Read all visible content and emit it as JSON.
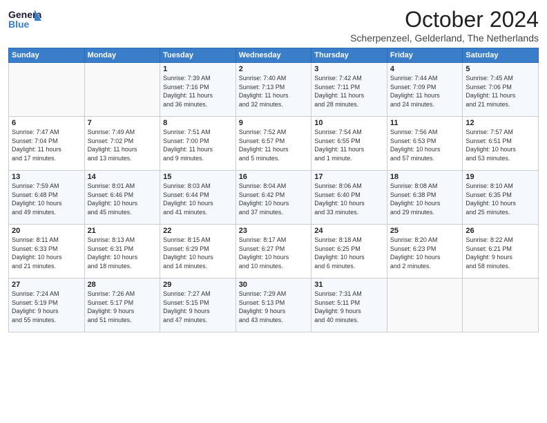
{
  "header": {
    "logo_general": "General",
    "logo_blue": "Blue",
    "month_title": "October 2024",
    "subtitle": "Scherpenzeel, Gelderland, The Netherlands"
  },
  "days_of_week": [
    "Sunday",
    "Monday",
    "Tuesday",
    "Wednesday",
    "Thursday",
    "Friday",
    "Saturday"
  ],
  "weeks": [
    [
      {
        "day": "",
        "info": ""
      },
      {
        "day": "",
        "info": ""
      },
      {
        "day": "1",
        "info": "Sunrise: 7:39 AM\nSunset: 7:16 PM\nDaylight: 11 hours\nand 36 minutes."
      },
      {
        "day": "2",
        "info": "Sunrise: 7:40 AM\nSunset: 7:13 PM\nDaylight: 11 hours\nand 32 minutes."
      },
      {
        "day": "3",
        "info": "Sunrise: 7:42 AM\nSunset: 7:11 PM\nDaylight: 11 hours\nand 28 minutes."
      },
      {
        "day": "4",
        "info": "Sunrise: 7:44 AM\nSunset: 7:09 PM\nDaylight: 11 hours\nand 24 minutes."
      },
      {
        "day": "5",
        "info": "Sunrise: 7:45 AM\nSunset: 7:06 PM\nDaylight: 11 hours\nand 21 minutes."
      }
    ],
    [
      {
        "day": "6",
        "info": "Sunrise: 7:47 AM\nSunset: 7:04 PM\nDaylight: 11 hours\nand 17 minutes."
      },
      {
        "day": "7",
        "info": "Sunrise: 7:49 AM\nSunset: 7:02 PM\nDaylight: 11 hours\nand 13 minutes."
      },
      {
        "day": "8",
        "info": "Sunrise: 7:51 AM\nSunset: 7:00 PM\nDaylight: 11 hours\nand 9 minutes."
      },
      {
        "day": "9",
        "info": "Sunrise: 7:52 AM\nSunset: 6:57 PM\nDaylight: 11 hours\nand 5 minutes."
      },
      {
        "day": "10",
        "info": "Sunrise: 7:54 AM\nSunset: 6:55 PM\nDaylight: 11 hours\nand 1 minute."
      },
      {
        "day": "11",
        "info": "Sunrise: 7:56 AM\nSunset: 6:53 PM\nDaylight: 10 hours\nand 57 minutes."
      },
      {
        "day": "12",
        "info": "Sunrise: 7:57 AM\nSunset: 6:51 PM\nDaylight: 10 hours\nand 53 minutes."
      }
    ],
    [
      {
        "day": "13",
        "info": "Sunrise: 7:59 AM\nSunset: 6:48 PM\nDaylight: 10 hours\nand 49 minutes."
      },
      {
        "day": "14",
        "info": "Sunrise: 8:01 AM\nSunset: 6:46 PM\nDaylight: 10 hours\nand 45 minutes."
      },
      {
        "day": "15",
        "info": "Sunrise: 8:03 AM\nSunset: 6:44 PM\nDaylight: 10 hours\nand 41 minutes."
      },
      {
        "day": "16",
        "info": "Sunrise: 8:04 AM\nSunset: 6:42 PM\nDaylight: 10 hours\nand 37 minutes."
      },
      {
        "day": "17",
        "info": "Sunrise: 8:06 AM\nSunset: 6:40 PM\nDaylight: 10 hours\nand 33 minutes."
      },
      {
        "day": "18",
        "info": "Sunrise: 8:08 AM\nSunset: 6:38 PM\nDaylight: 10 hours\nand 29 minutes."
      },
      {
        "day": "19",
        "info": "Sunrise: 8:10 AM\nSunset: 6:35 PM\nDaylight: 10 hours\nand 25 minutes."
      }
    ],
    [
      {
        "day": "20",
        "info": "Sunrise: 8:11 AM\nSunset: 6:33 PM\nDaylight: 10 hours\nand 21 minutes."
      },
      {
        "day": "21",
        "info": "Sunrise: 8:13 AM\nSunset: 6:31 PM\nDaylight: 10 hours\nand 18 minutes."
      },
      {
        "day": "22",
        "info": "Sunrise: 8:15 AM\nSunset: 6:29 PM\nDaylight: 10 hours\nand 14 minutes."
      },
      {
        "day": "23",
        "info": "Sunrise: 8:17 AM\nSunset: 6:27 PM\nDaylight: 10 hours\nand 10 minutes."
      },
      {
        "day": "24",
        "info": "Sunrise: 8:18 AM\nSunset: 6:25 PM\nDaylight: 10 hours\nand 6 minutes."
      },
      {
        "day": "25",
        "info": "Sunrise: 8:20 AM\nSunset: 6:23 PM\nDaylight: 10 hours\nand 2 minutes."
      },
      {
        "day": "26",
        "info": "Sunrise: 8:22 AM\nSunset: 6:21 PM\nDaylight: 9 hours\nand 58 minutes."
      }
    ],
    [
      {
        "day": "27",
        "info": "Sunrise: 7:24 AM\nSunset: 5:19 PM\nDaylight: 9 hours\nand 55 minutes."
      },
      {
        "day": "28",
        "info": "Sunrise: 7:26 AM\nSunset: 5:17 PM\nDaylight: 9 hours\nand 51 minutes."
      },
      {
        "day": "29",
        "info": "Sunrise: 7:27 AM\nSunset: 5:15 PM\nDaylight: 9 hours\nand 47 minutes."
      },
      {
        "day": "30",
        "info": "Sunrise: 7:29 AM\nSunset: 5:13 PM\nDaylight: 9 hours\nand 43 minutes."
      },
      {
        "day": "31",
        "info": "Sunrise: 7:31 AM\nSunset: 5:11 PM\nDaylight: 9 hours\nand 40 minutes."
      },
      {
        "day": "",
        "info": ""
      },
      {
        "day": "",
        "info": ""
      }
    ]
  ]
}
